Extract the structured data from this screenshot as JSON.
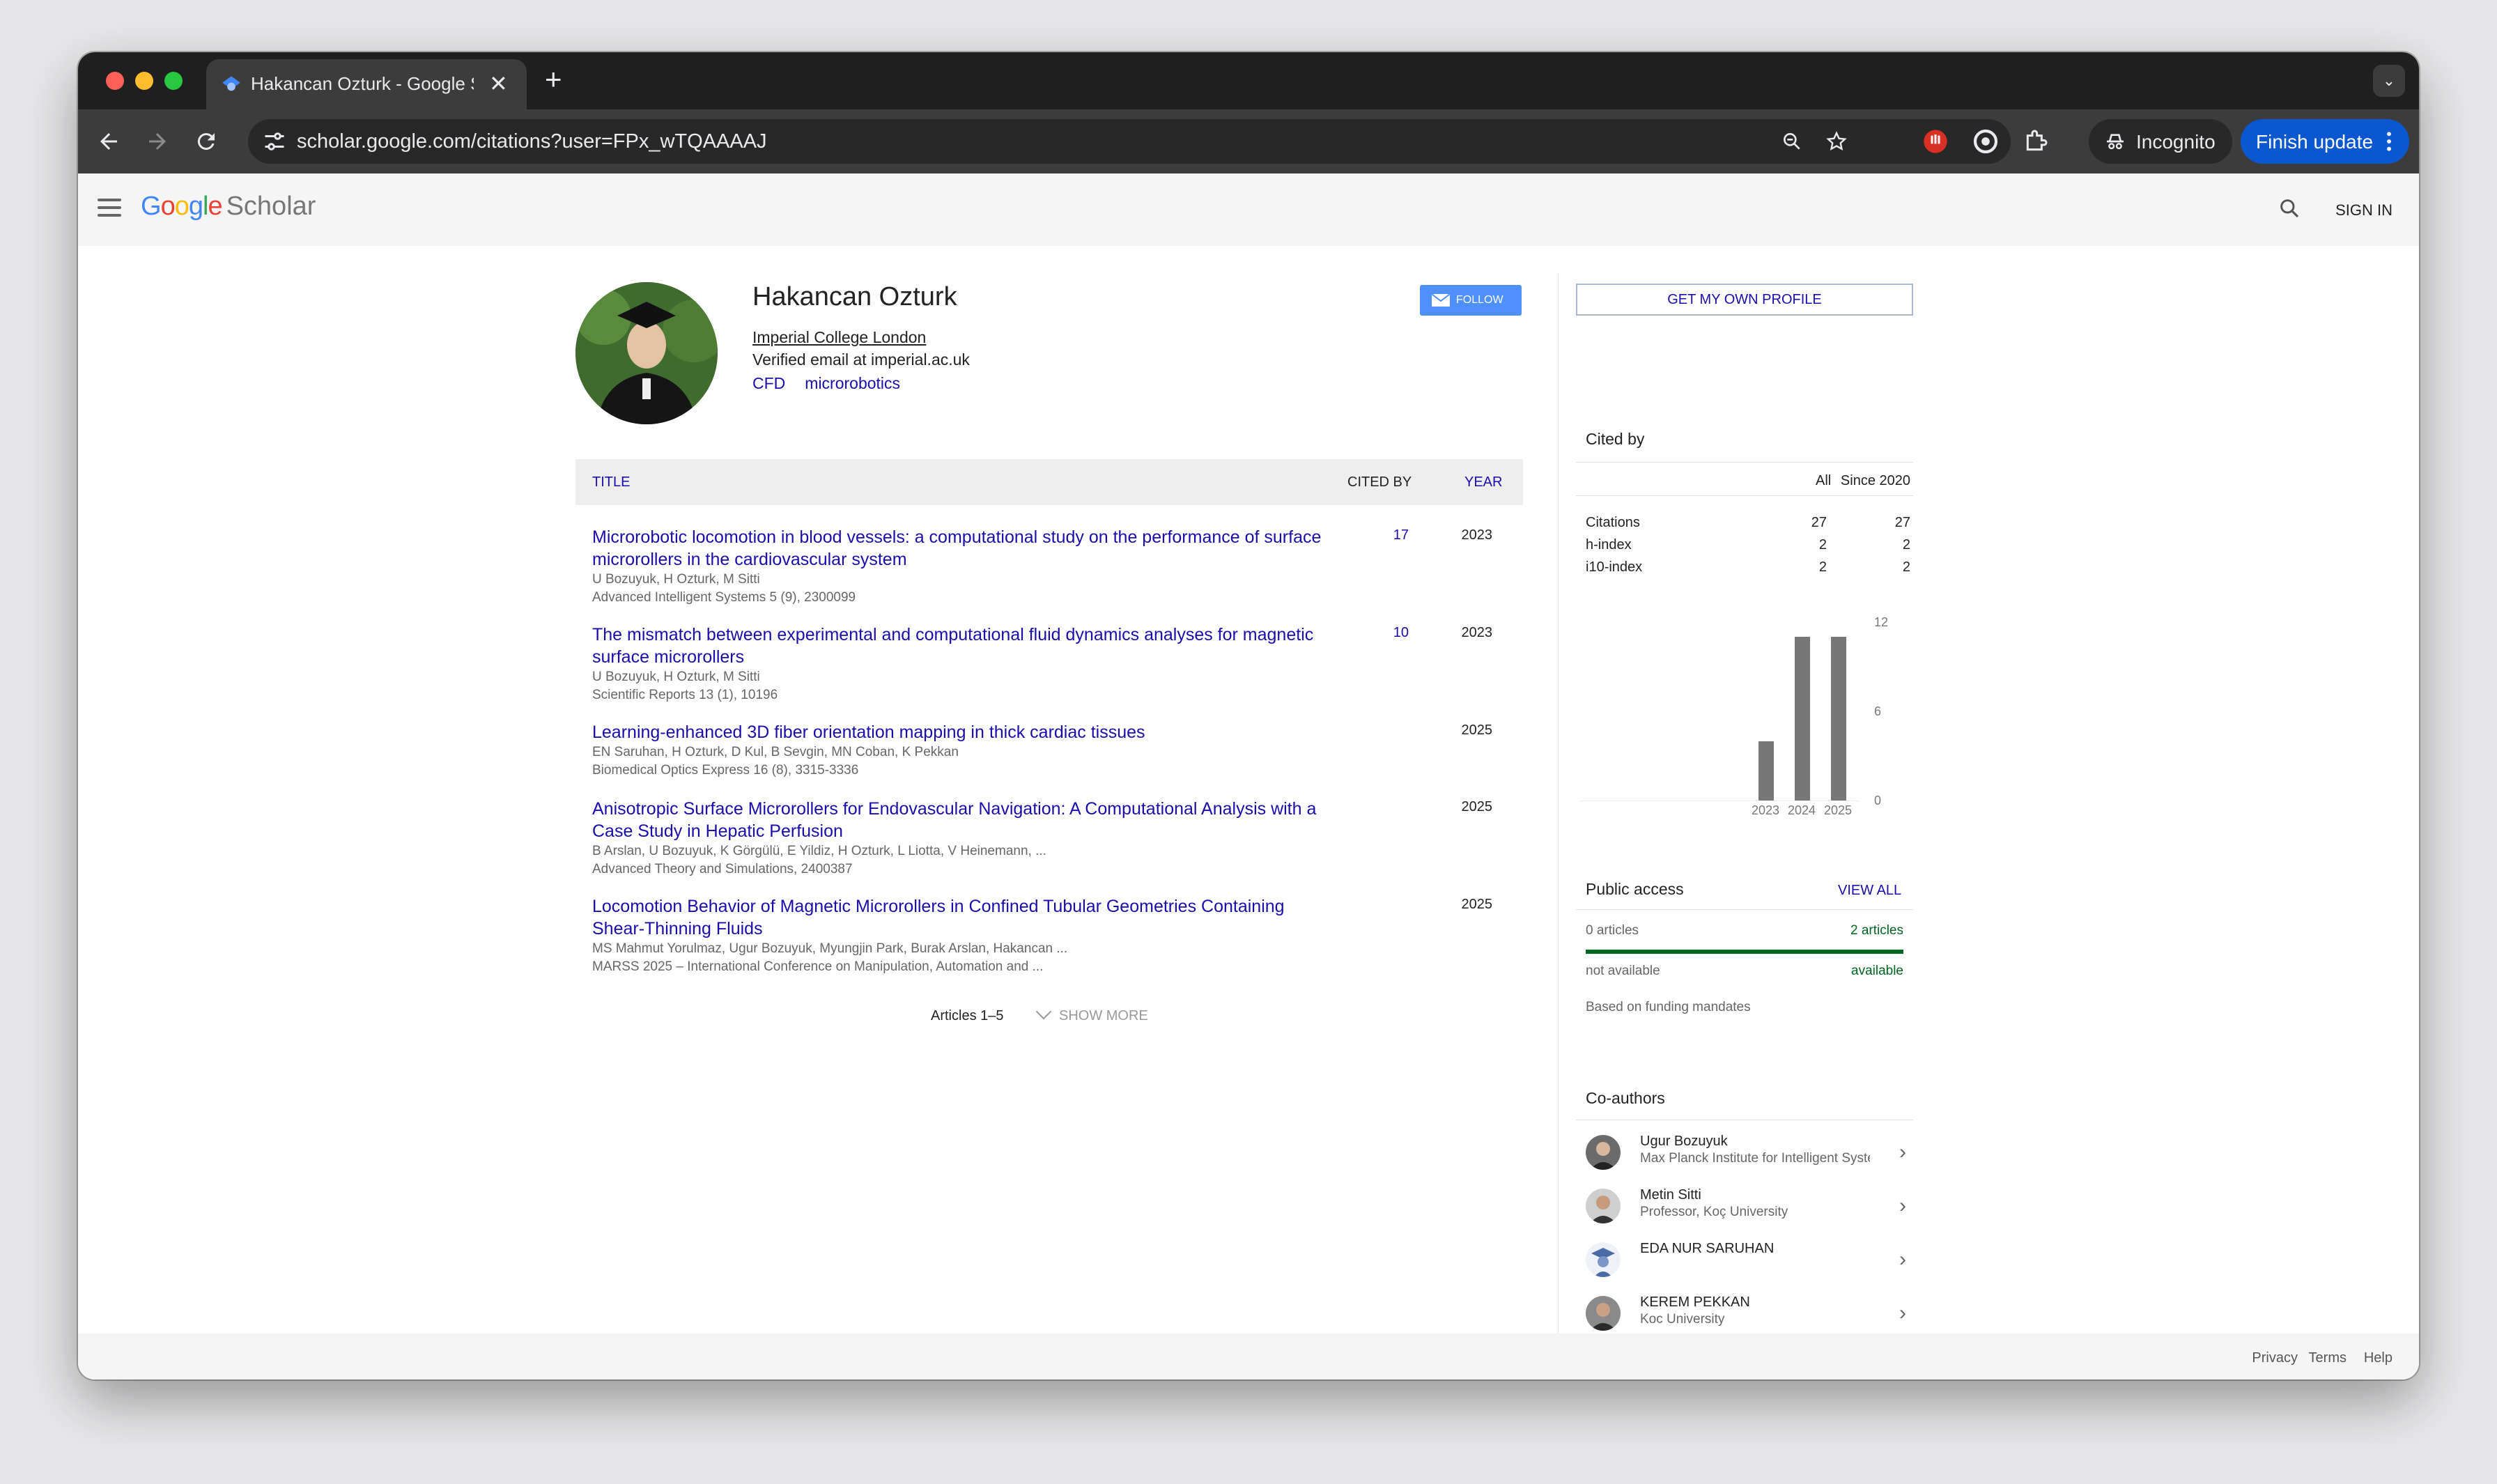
{
  "browser": {
    "tab_title": "Hakancan Ozturk - Google Scholar",
    "close_glyph": "✕",
    "new_tab_glyph": "+",
    "tab_search_glyph": "⌄",
    "url": "scholar.google.com/citations?user=FPx_wTQAAAAJ",
    "incognito_label": "Incognito",
    "finish_update_label": "Finish update",
    "icons": [
      "back-icon",
      "forward-icon",
      "reload-icon",
      "site-info-icon",
      "zoom-icon",
      "bookmark-star-icon",
      "extension-icon",
      "incognito-icon",
      "kebab-menu-icon"
    ]
  },
  "header": {
    "logo_google": "Google",
    "logo_scholar": "Scholar",
    "sign_in": "SIGN IN"
  },
  "profile": {
    "name": "Hakancan Ozturk",
    "affiliation": "Imperial College London",
    "email": "Verified email at imperial.ac.uk",
    "interests": [
      "CFD",
      "microrobotics"
    ],
    "follow_label": "FOLLOW",
    "get_profile_label": "GET MY OWN PROFILE"
  },
  "articles": {
    "headers": {
      "title": "TITLE",
      "cited_by": "CITED BY",
      "year": "YEAR"
    },
    "rows": [
      {
        "title": "Microrobotic locomotion in blood vessels: a computational study on the performance of surface microrollers in the cardiovascular system",
        "authors": "U Bozuyuk, H Ozturk, M Sitti",
        "venue": "Advanced Intelligent Systems 5 (9), 2300099",
        "cited": "17",
        "year": "2023"
      },
      {
        "title": "The mismatch between experimental and computational fluid dynamics analyses for magnetic surface microrollers",
        "authors": "U Bozuyuk, H Ozturk, M Sitti",
        "venue": "Scientific Reports 13 (1), 10196",
        "cited": "10",
        "year": "2023"
      },
      {
        "title": "Learning-enhanced 3D fiber orientation mapping in thick cardiac tissues",
        "authors": "EN Saruhan, H Ozturk, D Kul, B Sevgin, MN Coban, K Pekkan",
        "venue": "Biomedical Optics Express 16 (8), 3315-3336",
        "cited": "",
        "year": "2025"
      },
      {
        "title": "Anisotropic Surface Microrollers for Endovascular Navigation: A Computational Analysis with a Case Study in Hepatic Perfusion",
        "authors": "B Arslan, U Bozuyuk, K Görgülü, E Yildiz, H Ozturk, L Liotta, V Heinemann, ...",
        "venue": "Advanced Theory and Simulations, 2400387",
        "cited": "",
        "year": "2025"
      },
      {
        "title": "Locomotion Behavior of Magnetic Microrollers in Confined Tubular Geometries Containing Shear-Thinning Fluids",
        "authors": "MS Mahmut Yorulmaz, Ugur Bozuyuk, Myungjin Park, Burak Arslan, Hakancan ...",
        "venue": "MARSS 2025 – International Conference on Manipulation, Automation and ...",
        "cited": "",
        "year": "2025"
      }
    ],
    "pager": "Articles 1–5",
    "show_more": "SHOW MORE"
  },
  "cited_by": {
    "title": "Cited by",
    "col_all": "All",
    "col_since": "Since 2020",
    "rows": [
      {
        "label": "Citations",
        "all": "27",
        "since": "27"
      },
      {
        "label": "h-index",
        "all": "2",
        "since": "2"
      },
      {
        "label": "i10-index",
        "all": "2",
        "since": "2"
      }
    ]
  },
  "chart_data": {
    "type": "bar",
    "categories": [
      "2023",
      "2024",
      "2025"
    ],
    "values": [
      4,
      11,
      11
    ],
    "ylim": [
      0,
      12
    ],
    "yticks": [
      "12",
      "6",
      "0"
    ],
    "bar_color": "#777777"
  },
  "public_access": {
    "title": "Public access",
    "view_all": "VIEW ALL",
    "not_available_count": "0 articles",
    "available_count": "2 articles",
    "not_available_label": "not available",
    "available_label": "available",
    "available_fraction": 1.0,
    "note": "Based on funding mandates",
    "green": "#006621"
  },
  "coauthors": {
    "title": "Co-authors",
    "items": [
      {
        "name": "Ugur Bozuyuk",
        "affiliation": "Max Planck Institute for Intelligent Systems"
      },
      {
        "name": "Metin Sitti",
        "affiliation": "Professor, Koç University"
      },
      {
        "name": "EDA NUR SARUHAN",
        "affiliation": ""
      },
      {
        "name": "KEREM PEKKAN",
        "affiliation": "Koc University"
      }
    ]
  },
  "footer": {
    "privacy": "Privacy",
    "terms": "Terms",
    "help": "Help"
  }
}
